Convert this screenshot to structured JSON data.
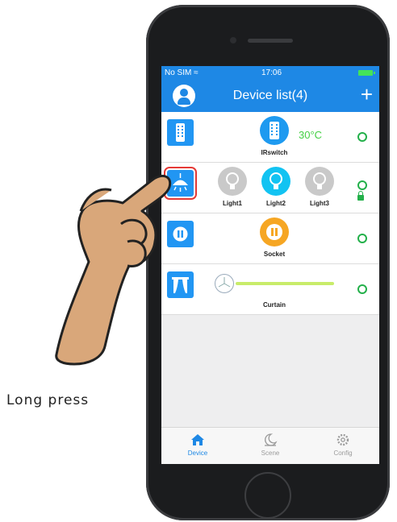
{
  "status_bar": {
    "carrier": "No SIM",
    "time": "17:06"
  },
  "nav": {
    "title": "Device list(4)",
    "add_label": "+"
  },
  "devices": [
    {
      "caption": "IRswitch",
      "temperature": "30°C"
    },
    {
      "lights": [
        "Light1",
        "Light2",
        "Light3"
      ]
    },
    {
      "caption": "Socket"
    },
    {
      "caption": "Curtain"
    }
  ],
  "tabs": [
    "Device",
    "Scene",
    "Config"
  ],
  "overlay": {
    "instruction": "Long press"
  },
  "colors": {
    "accent": "#1e88e5",
    "status_green": "#23b04a",
    "temp_green": "#44d044",
    "selection_red": "#e53935",
    "socket_orange": "#f6a623"
  },
  "icons": [
    "user-icon",
    "add-icon",
    "ir-remote-icon",
    "ceiling-lamp-icon",
    "bulb-icon",
    "socket-icon",
    "curtain-icon",
    "lock-icon",
    "home-icon",
    "scene-icon",
    "gear-icon",
    "pointing-hand"
  ]
}
